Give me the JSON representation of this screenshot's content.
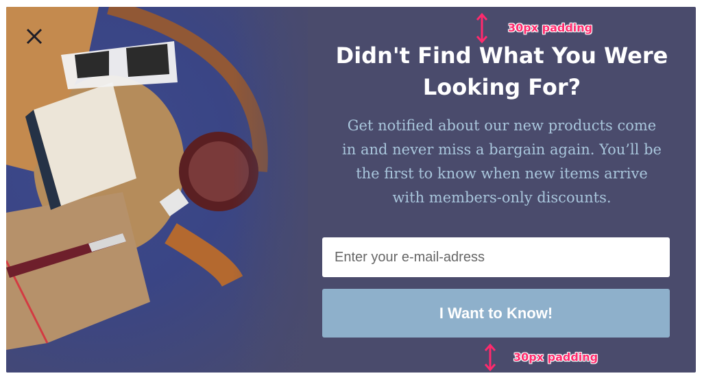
{
  "popup": {
    "headline_line1": "Didn't Find What You Were",
    "headline_line2": "Looking For?",
    "body_line1": "Get notified about our new products come",
    "body_line2": "in and never miss a bargain again. You’ll be",
    "body_line3": "the first to know when new items arrive",
    "body_line4": "with members-only discounts.",
    "email_placeholder": "Enter your e-mail-adress",
    "cta_label": "I Want to Know!",
    "close_icon": "close-icon"
  },
  "annotations": {
    "top_label": "30px padding",
    "bottom_label": "30px padding"
  },
  "colors": {
    "background": "#4a4b6c",
    "headline": "#ffffff",
    "body_text": "#a9c6dc",
    "cta_background": "#8eb0cb",
    "annotation": "#ff2a6d"
  }
}
